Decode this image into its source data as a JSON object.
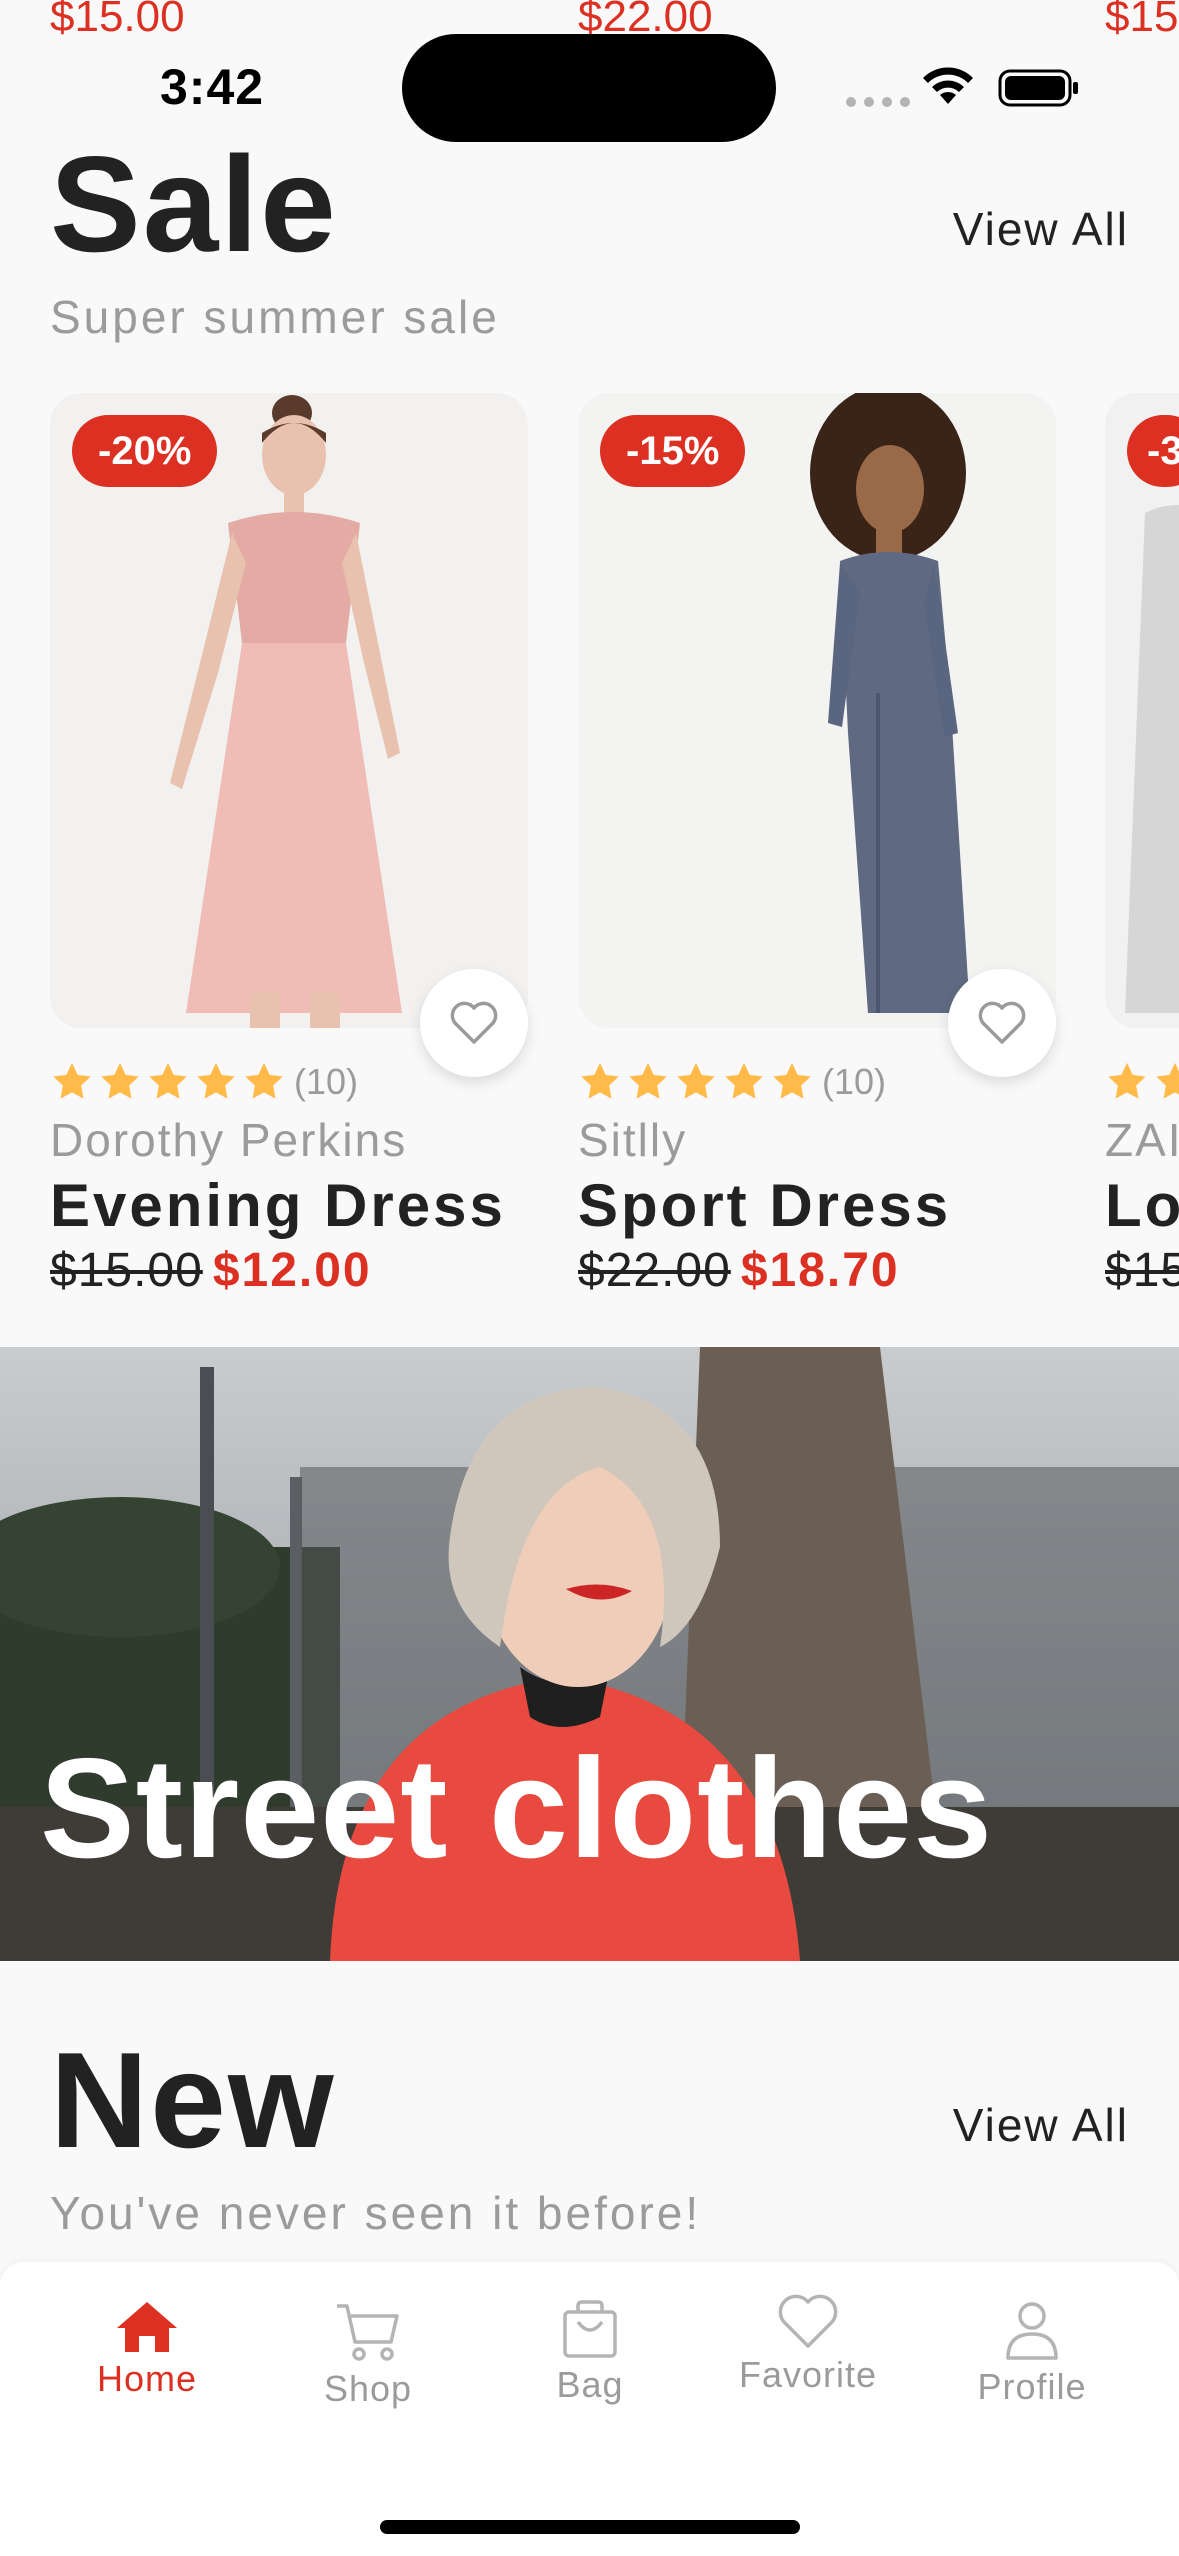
{
  "peek_row": {
    "price_left": "$15.00",
    "price_mid": "$22.00",
    "price_right": "$15"
  },
  "status_bar": {
    "time": "3:42"
  },
  "sale": {
    "title": "Sale",
    "subtitle": "Super summer sale",
    "view_all": "View All",
    "products": [
      {
        "discount": "-20%",
        "rating": 5,
        "reviews": "(10)",
        "brand": "Dorothy Perkins",
        "name": "Evening Dress",
        "old_price": "$15.00",
        "price": "$12.00"
      },
      {
        "discount": "-15%",
        "rating": 5,
        "reviews": "(10)",
        "brand": "Sitlly",
        "name": "Sport Dress",
        "old_price": "$22.00",
        "price": "$18.70"
      },
      {
        "discount": "-3",
        "rating": 5,
        "reviews": "",
        "brand": "ZAI",
        "name": "Lo",
        "old_price": "$15",
        "price": ""
      }
    ]
  },
  "banner": {
    "title": "Street clothes"
  },
  "new_section": {
    "title": "New",
    "subtitle": "You've never seen it before!",
    "view_all": "View All"
  },
  "tab_bar": {
    "items": [
      {
        "label": "Home",
        "icon": "home-icon",
        "active": true
      },
      {
        "label": "Shop",
        "icon": "cart-icon",
        "active": false
      },
      {
        "label": "Bag",
        "icon": "bag-icon",
        "active": false
      },
      {
        "label": "Favorite",
        "icon": "heart-icon",
        "active": false
      },
      {
        "label": "Profile",
        "icon": "profile-icon",
        "active": false
      }
    ]
  },
  "colors": {
    "accent": "#DB3022",
    "text": "#222222",
    "muted": "#9B9B9B",
    "star": "#FFBA49",
    "background": "#F9F9F9"
  }
}
